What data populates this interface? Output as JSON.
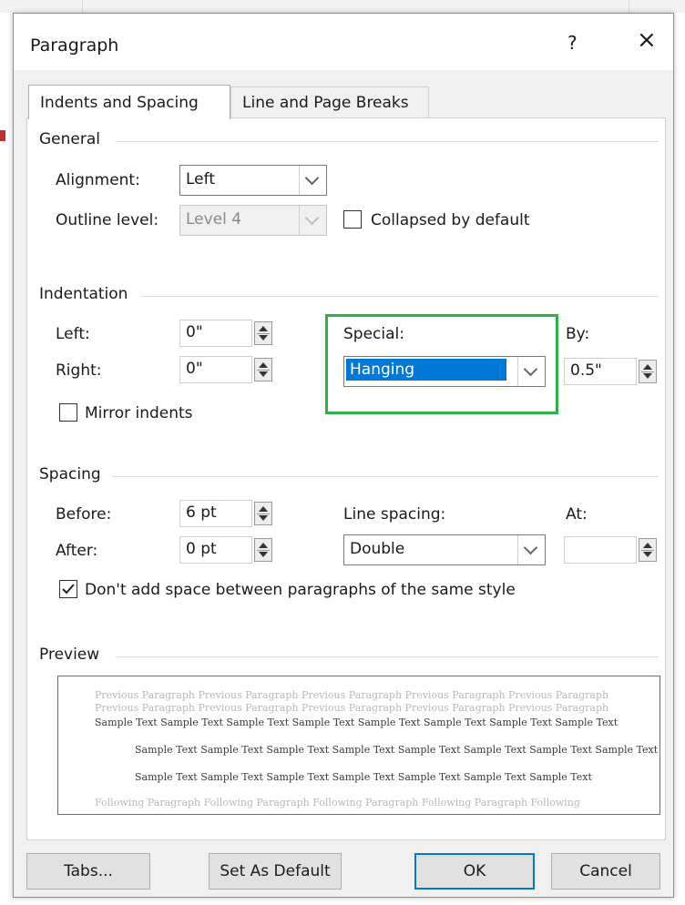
{
  "dialog": {
    "title": "Paragraph",
    "help_label": "?",
    "close_label": "×"
  },
  "tabs": [
    {
      "label": "Indents and Spacing",
      "active": true
    },
    {
      "label": "Line and Page Breaks",
      "active": false
    }
  ],
  "general": {
    "heading": "General",
    "alignment_label": "Alignment:",
    "alignment_value": "Left",
    "outline_level_label": "Outline level:",
    "outline_level_value": "Level 4",
    "collapsed_label": "Collapsed by default",
    "collapsed_checked": false
  },
  "indentation": {
    "heading": "Indentation",
    "left_label": "Left:",
    "left_value": "0\"",
    "right_label": "Right:",
    "right_value": "0\"",
    "special_label": "Special:",
    "special_value": "Hanging",
    "by_label": "By:",
    "by_value": "0.5\"",
    "mirror_label": "Mirror indents",
    "mirror_checked": false
  },
  "spacing": {
    "heading": "Spacing",
    "before_label": "Before:",
    "before_value": "6 pt",
    "after_label": "After:",
    "after_value": "0 pt",
    "line_spacing_label": "Line spacing:",
    "line_spacing_value": "Double",
    "at_label": "At:",
    "at_value": "",
    "dont_add_label": "Don't add space between paragraphs of the same style",
    "dont_add_checked": true
  },
  "preview": {
    "heading": "Preview",
    "previous_lines": [
      "Previous Paragraph Previous Paragraph Previous Paragraph Previous Paragraph Previous Paragraph",
      "Previous Paragraph Previous Paragraph Previous Paragraph Previous Paragraph Previous Paragraph"
    ],
    "sample_lines": [
      "Sample Text Sample Text Sample Text Sample Text Sample Text Sample Text Sample Text Sample Text",
      "Sample Text Sample Text Sample Text Sample Text Sample Text Sample Text Sample Text Sample Text",
      "Sample Text Sample Text Sample Text Sample Text Sample Text Sample Text Sample Text"
    ],
    "following_line": "Following Paragraph Following Paragraph Following Paragraph Following Paragraph Following"
  },
  "buttons": {
    "tabs": "Tabs...",
    "set_default": "Set As Default",
    "ok": "OK",
    "cancel": "Cancel"
  },
  "colors": {
    "highlight": "#2fb14a",
    "selection": "#0078d7",
    "accent": "#0078d7"
  }
}
